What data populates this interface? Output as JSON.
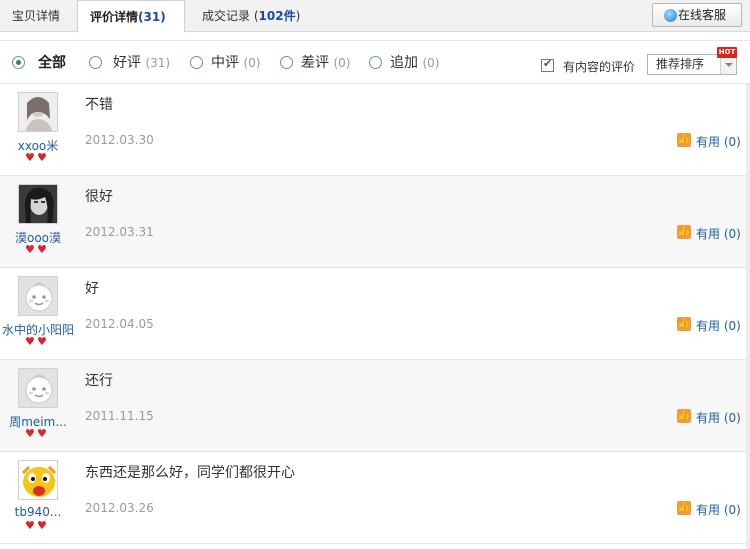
{
  "tabs": [
    {
      "label": "宝贝详情",
      "count": ""
    },
    {
      "label": "评价详情",
      "count": "31"
    },
    {
      "label": "成交记录",
      "count": "102件"
    }
  ],
  "service_button": "在线客服",
  "filters": [
    {
      "label": "全部",
      "count": "",
      "selected": true
    },
    {
      "label": "好评",
      "count": "(31)",
      "selected": false
    },
    {
      "label": "中评",
      "count": "(0)",
      "selected": false
    },
    {
      "label": "差评",
      "count": "(0)",
      "selected": false
    },
    {
      "label": "追加",
      "count": "(0)",
      "selected": false
    }
  ],
  "content_only": {
    "label": "有内容的评价",
    "checked": true
  },
  "sort": {
    "selected": "推荐排序",
    "badge": "HOT"
  },
  "reviews": [
    {
      "user": "xxoo米",
      "text": "不错",
      "date": "2012.03.30",
      "useful": "有用 (0)",
      "avatar": "photo-girl-light"
    },
    {
      "user": "漠ooo漠",
      "text": "很好",
      "date": "2012.03.31",
      "useful": "有用 (0)",
      "avatar": "photo-girl-dark"
    },
    {
      "user": "水中的小阳阳",
      "text": "好",
      "date": "2012.04.05",
      "useful": "有用 (0)",
      "avatar": "default-face"
    },
    {
      "user": "周meim...",
      "text": "还行",
      "date": "2011.11.15",
      "useful": "有用 (0)",
      "avatar": "default-face"
    },
    {
      "user": "tb940...",
      "text": "东西还是那么好，同学们都很开心",
      "date": "2012.03.26",
      "useful": "有用 (0)",
      "avatar": "cartoon-chick"
    }
  ],
  "colors": {
    "link": "#1f5da8",
    "count": "#1a4aa8",
    "heart": "#d9252c",
    "useful_icon": "#f29b38",
    "hot": "#d9251c"
  }
}
